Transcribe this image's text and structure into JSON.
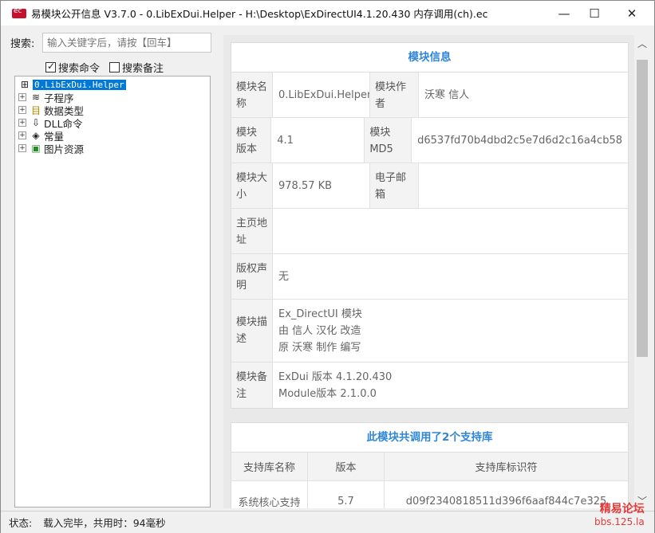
{
  "window": {
    "title": "易模块公开信息 V3.7.0 - 0.LibExDui.Helper - H:\\Desktop\\ExDirectUI4.1.20.430 内存调用(ch).ec",
    "controls": {
      "minimize": "—",
      "maximize": "☐",
      "close": "✕"
    }
  },
  "search": {
    "label": "搜索:",
    "placeholder": "输入关键字后，请按【回车】",
    "options": [
      {
        "label": "搜索命令",
        "checked": true
      },
      {
        "label": "搜索备注",
        "checked": false
      }
    ]
  },
  "tree": {
    "root": "0.LibExDui.Helper",
    "items": [
      {
        "label": "子程序",
        "icon": "layers-icon"
      },
      {
        "label": "数据类型",
        "icon": "data-type-icon"
      },
      {
        "label": "DLL命令",
        "icon": "dll-icon"
      },
      {
        "label": "常量",
        "icon": "constant-icon"
      },
      {
        "label": "图片资源",
        "icon": "image-resource-icon"
      }
    ]
  },
  "module_info": {
    "title": "模块信息",
    "rows": [
      {
        "k1": "模块名称",
        "v1": "0.LibExDui.Helper",
        "k2": "模块作者",
        "v2": "沃寒 信人"
      },
      {
        "k1": "模块版本",
        "v1": "4.1",
        "k2": "模块MD5",
        "v2": "d6537fd70b4dbd2c5e7d6d2c16a4cb58"
      },
      {
        "k1": "模块大小",
        "v1": "978.57 KB",
        "k2": "电子邮箱",
        "v2": ""
      }
    ],
    "homepage": {
      "k": "主页地址",
      "v": ""
    },
    "copyright": {
      "k": "版权声明",
      "v": "无"
    },
    "desc": {
      "k": "模块描述",
      "lines": [
        "Ex_DirectUI 模块",
        "由 信人 汉化 改造",
        "原 沃寒 制作 编写"
      ]
    },
    "remark": {
      "k": "模块备注",
      "lines": [
        "ExDui 版本 4.1.20.430",
        "Module版本 2.1.0.0"
      ]
    }
  },
  "support": {
    "title": "此模块共调用了2个支持库",
    "headers": [
      "支持库名称",
      "版本",
      "支持库标识符"
    ],
    "rows": [
      {
        "name": "系统核心支持",
        "version": "5.7",
        "id": "d09f2340818511d396f6aaf844c7e325"
      }
    ]
  },
  "status": {
    "label": "状态:",
    "text": "载入完毕，共用时：94毫秒"
  },
  "watermark": {
    "line1": "精易论坛",
    "line2": "bbs.125.la"
  }
}
